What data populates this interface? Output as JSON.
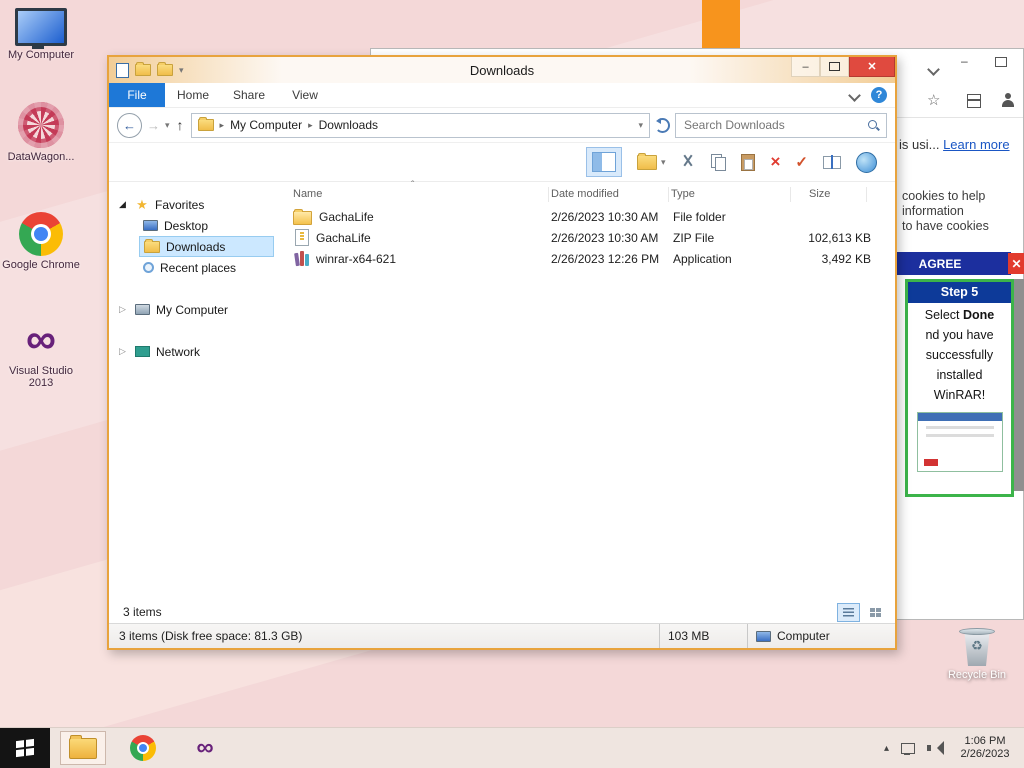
{
  "desktop": {
    "icons": [
      {
        "label": "My Computer"
      },
      {
        "label": "DataWagon..."
      },
      {
        "label": "Google Chrome"
      },
      {
        "label": "Visual Studio 2013"
      }
    ],
    "recycle_bin_label": "Recycle Bin"
  },
  "explorer": {
    "title": "Downloads",
    "tabs": {
      "file": "File",
      "home": "Home",
      "share": "Share",
      "view": "View"
    },
    "address": {
      "crumb_root": "My Computer",
      "crumb_current": "Downloads",
      "search_placeholder": "Search Downloads"
    },
    "nav": {
      "favorites_label": "Favorites",
      "desktop_label": "Desktop",
      "downloads_label": "Downloads",
      "recent_label": "Recent places",
      "computer_label": "My Computer",
      "network_label": "Network"
    },
    "columns": {
      "name": "Name",
      "modified": "Date modified",
      "type": "Type",
      "size": "Size"
    },
    "files": [
      {
        "name": "GachaLife",
        "modified": "2/26/2023 10:30 AM",
        "type": "File folder",
        "size": ""
      },
      {
        "name": "GachaLife",
        "modified": "2/26/2023 10:30 AM",
        "type": "ZIP File",
        "size": "102,613 KB"
      },
      {
        "name": "winrar-x64-621",
        "modified": "2/26/2023 12:26 PM",
        "type": "Application",
        "size": "3,492 KB"
      }
    ],
    "statusbar": {
      "count": "3 items",
      "details": "3 items (Disk free space: 81.3 GB)",
      "size": "103 MB",
      "location": "Computer"
    }
  },
  "browser": {
    "snippet_prefix": "is usi... ",
    "learn_more": "Learn more",
    "cookie_lines": [
      "cookies to help",
      "information",
      "to have cookies"
    ],
    "agree_label": "AGREE",
    "step": {
      "title": "Step 5",
      "line1_prefix": "Select ",
      "line1_bold": "Done",
      "line2": "nd you have",
      "line3": "successfully",
      "line4": "installed",
      "line5": "WinRAR!"
    }
  },
  "taskbar": {
    "time": "1:06 PM",
    "date": "2/26/2023"
  }
}
